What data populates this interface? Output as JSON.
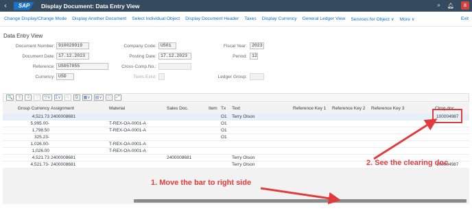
{
  "shell": {
    "logo": "SAP",
    "title": "Display Document: Data Entry View",
    "back_icon": "‹",
    "avatar": "8"
  },
  "toolbar": {
    "items": [
      "Change Display/Change Mode",
      "Display Another Document",
      "Select Individual Object",
      "Display Document Header",
      "Taxes",
      "Display Currency",
      "General Ledger View",
      "Services for Object ∨",
      "More ∨"
    ],
    "exit": "Exit"
  },
  "section_title": "Data Entry View",
  "form": {
    "document_number_label": "Document Number:",
    "document_number": "910029919",
    "company_code_label": "Company Code:",
    "company_code": "US01",
    "fiscal_year_label": "Fiscal Year:",
    "fiscal_year": "2023",
    "document_date_label": "Document Date:",
    "document_date": "17.12.2023",
    "posting_date_label": "Posting Date:",
    "posting_date": "17.12.2023",
    "period_label": "Period:",
    "period": "12",
    "reference_label": "Reference:",
    "reference": "US057055",
    "cross_comp_label": "Cross-Comp.No.:",
    "cross_comp": "",
    "currency_label": "Currency:",
    "currency": "USD",
    "texts_exist_label": "Texts Exist:",
    "ledger_group_label": "Ledger Group:",
    "ledger_group": ""
  },
  "grid_toolbar": [
    "🔍",
    "⇧",
    "⇩",
    "▽",
    "▽∨",
    "Σ∨",
    "½",
    "⎙",
    "▦∨",
    "▤∨",
    "ⓘ",
    "⤢"
  ],
  "columns": [
    "Group Currency",
    "Assignment",
    "Material",
    "Sales Doc.",
    "Item",
    "Tx",
    "Text",
    "Reference Key 1",
    "Reference Key 2",
    "Reference Key 3",
    "Clrng doc."
  ],
  "rows": [
    {
      "amount": "4,521.73",
      "assignment": "2400008681",
      "material": "",
      "sales_doc": "",
      "item": "",
      "tx": "O1",
      "text": "Terry Olson",
      "clrng": "100004987"
    },
    {
      "amount": "5,995.00-",
      "assignment": "",
      "material": "T-REX-OA-0001-A",
      "sales_doc": "",
      "item": "",
      "tx": "O1",
      "text": "",
      "clrng": ""
    },
    {
      "amount": "1,798.50",
      "assignment": "",
      "material": "T-REX-OA-0001-A",
      "sales_doc": "",
      "item": "",
      "tx": "O1",
      "text": "",
      "clrng": ""
    },
    {
      "amount": "325.23-",
      "assignment": "",
      "material": "",
      "sales_doc": "",
      "item": "",
      "tx": "O1",
      "text": "",
      "clrng": ""
    },
    {
      "amount": "1,026.00-",
      "assignment": "",
      "material": "T-REX-OA-0001-A",
      "sales_doc": "",
      "item": "",
      "tx": "",
      "text": "",
      "clrng": ""
    },
    {
      "amount": "1,026.00",
      "assignment": "",
      "material": "T-REX-OA-0001-A",
      "sales_doc": "",
      "item": "",
      "tx": "",
      "text": "",
      "clrng": ""
    },
    {
      "amount": "4,521.73",
      "assignment": "2400008681",
      "material": "",
      "sales_doc": "2400008681",
      "item": "",
      "tx": "",
      "text": "Terry Olson",
      "clrng": ""
    },
    {
      "amount": "4,521.73-",
      "assignment": "2400008681",
      "material": "",
      "sales_doc": "",
      "item": "",
      "tx": "",
      "text": "Terry Olson",
      "clrng": "100004987"
    }
  ],
  "annotations": {
    "step1": "1. Move the bar to right side",
    "step2": "2. See the clearing doc"
  },
  "colors": {
    "shell": "#354a5f",
    "link": "#0a6ed1",
    "annotation": "#e23b3b"
  }
}
